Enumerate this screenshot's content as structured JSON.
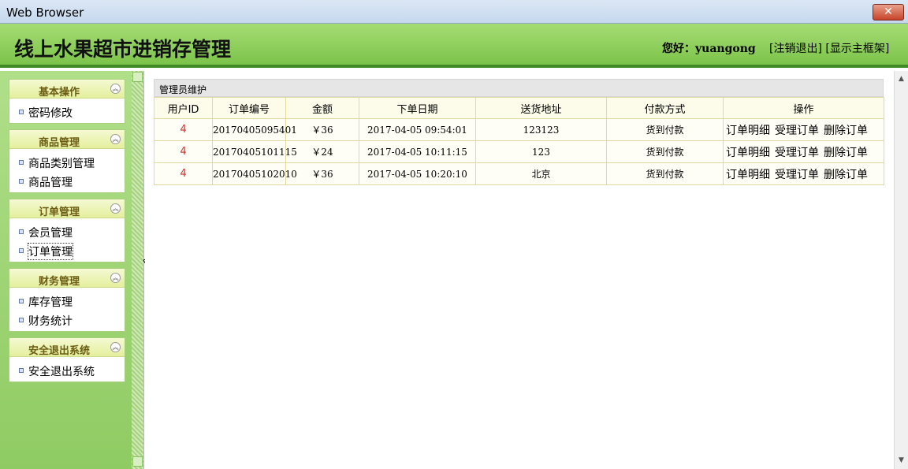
{
  "window": {
    "title": "Web Browser",
    "close_label": "✕"
  },
  "header": {
    "app_title": "线上水果超市进销存管理",
    "greeting": "您好：yuangong",
    "logout_link": "[注销退出]",
    "main_frame_link": "[显示主框架]"
  },
  "sidebar": {
    "groups": [
      {
        "title": "基本操作",
        "items": [
          {
            "label": "密码修改"
          }
        ]
      },
      {
        "title": "商品管理",
        "items": [
          {
            "label": "商品类别管理"
          },
          {
            "label": "商品管理"
          }
        ]
      },
      {
        "title": "订单管理",
        "items": [
          {
            "label": "会员管理"
          },
          {
            "label": "订单管理"
          }
        ]
      },
      {
        "title": "财务管理",
        "items": [
          {
            "label": "库存管理"
          },
          {
            "label": "财务统计"
          }
        ]
      },
      {
        "title": "安全退出系统",
        "items": [
          {
            "label": "安全退出系统"
          }
        ]
      }
    ]
  },
  "main": {
    "panel_title": "管理员维护",
    "columns": [
      "用户ID",
      "订单编号",
      "金额",
      "下单日期",
      "送货地址",
      "付款方式",
      "操作"
    ],
    "rows": [
      {
        "user_id": "4",
        "order_no": "20170405095401",
        "amount": "￥36",
        "date": "2017-04-05 09:54:01",
        "address": "123123",
        "payment": "货到付款"
      },
      {
        "user_id": "4",
        "order_no": "20170405101115",
        "amount": "￥24",
        "date": "2017-04-05 10:11:15",
        "address": "123",
        "payment": "货到付款"
      },
      {
        "user_id": "4",
        "order_no": "20170405102010",
        "amount": "￥36",
        "date": "2017-04-05 10:20:10",
        "address": "北京",
        "payment": "货到付款"
      }
    ],
    "actions": {
      "detail": "订单明细",
      "accept": "受理订单",
      "delete": "删除订单"
    }
  },
  "icons": {
    "collapse": "double-chevron-up-icon",
    "cursor": "hand-pointer-icon"
  },
  "colors": {
    "header_green": "#7cc34a",
    "header_border": "#3f8a26",
    "user_id_red": "#d42b2b"
  }
}
